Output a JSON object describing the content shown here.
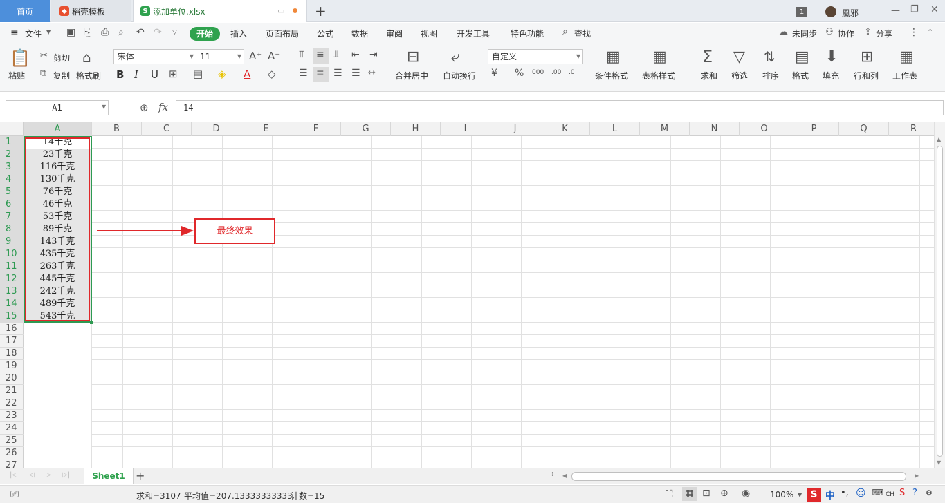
{
  "tabs": {
    "home": "首页",
    "template": "稻壳模板",
    "file": "添加单位.xlsx",
    "add": "+"
  },
  "user": {
    "badge": "1",
    "name": "風邪"
  },
  "menu": {
    "file": "文件",
    "items": [
      "开始",
      "插入",
      "页面布局",
      "公式",
      "数据",
      "审阅",
      "视图",
      "开发工具",
      "特色功能"
    ],
    "search": "查找",
    "sync": "未同步",
    "collab": "协作",
    "share": "分享"
  },
  "ribbon": {
    "paste": "粘贴",
    "cut": "剪切",
    "copy": "复制",
    "format_painter": "格式刷",
    "font_name": "宋体",
    "font_size": "11",
    "merge_center": "合并居中",
    "wrap": "自动换行",
    "number_format": "自定义",
    "cond_format": "条件格式",
    "table_style": "表格样式",
    "sum": "求和",
    "filter": "筛选",
    "sort": "排序",
    "format": "格式",
    "fill": "填充",
    "rowcol": "行和列",
    "worksheet": "工作表"
  },
  "formula_bar": {
    "cell_ref": "A1",
    "fx": "fx",
    "value": "14"
  },
  "columns": [
    "A",
    "B",
    "C",
    "D",
    "E",
    "F",
    "G",
    "H",
    "I",
    "J",
    "K",
    "L",
    "M",
    "N",
    "O",
    "P",
    "Q",
    "R"
  ],
  "rows": [
    "1",
    "2",
    "3",
    "4",
    "5",
    "6",
    "7",
    "8",
    "9",
    "10",
    "11",
    "12",
    "13",
    "14",
    "15",
    "16",
    "17",
    "18",
    "19",
    "20",
    "21",
    "22",
    "23",
    "24",
    "25",
    "26",
    "27"
  ],
  "cells": [
    "14千克",
    "23千克",
    "116千克",
    "130千克",
    "76千克",
    "46千克",
    "53千克",
    "89千克",
    "143千克",
    "435千克",
    "263千克",
    "445千克",
    "242千克",
    "489千克",
    "543千克"
  ],
  "annotation": "最终效果",
  "sheet": {
    "name": "Sheet1"
  },
  "status": {
    "sum": "求和=3107",
    "avg": "平均值=207.13333333333",
    "count": "计数=15",
    "zoom": "100%"
  },
  "colors": {
    "accent": "#4d8fdb",
    "start_tab": "#2fa24e",
    "selection": "#2e9a52",
    "annotation": "#e0282b"
  }
}
